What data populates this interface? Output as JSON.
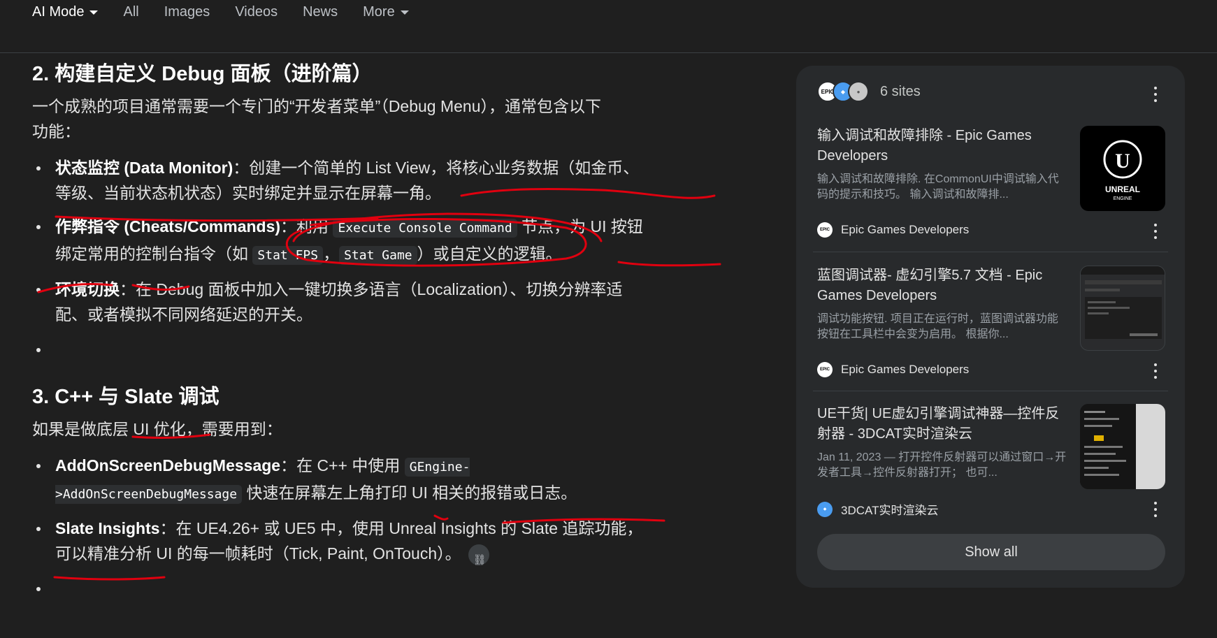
{
  "tabs": [
    {
      "label": "AI Mode",
      "active": true,
      "has_caret": true
    },
    {
      "label": "All"
    },
    {
      "label": "Images"
    },
    {
      "label": "Videos"
    },
    {
      "label": "News"
    },
    {
      "label": "More",
      "has_caret": true
    }
  ],
  "section2": {
    "heading": "2. 构建自定义 Debug 面板（进阶篇）",
    "intro": "一个成熟的项目通常需要一个专门的“开发者菜单”（Debug Menu），通常包含以下功能：",
    "items": [
      {
        "bold": "状态监控 (Data Monitor)",
        "text": "：创建一个简单的 List View，将核心业务数据（如金币、等级、当前状态机状态）实时绑定并显示在屏幕一角。"
      },
      {
        "bold": "作弊指令 (Cheats/Commands)",
        "t1": "：利用 ",
        "code1": "Execute Console Command",
        "t2": " 节点，为 UI 按钮绑定常用的控制台指令（如 ",
        "code2": "Stat FPS",
        "t3": "，",
        "code3": "Stat Game",
        "t4": "）或自定义的逻辑。"
      },
      {
        "bold": "环境切换",
        "text": "：在 Debug 面板中加入一键切换多语言（Localization）、切换分辨率适配、或者模拟不同网络延迟的开关。"
      }
    ]
  },
  "section3": {
    "heading": "3. C++ 与 Slate 调试",
    "intro": "如果是做底层 UI 优化，需要用到：",
    "items": [
      {
        "bold": "AddOnScreenDebugMessage",
        "t1": "：在 C++ 中使用 ",
        "code1": "GEngine->AddOnScreenDebugMessage",
        "t2": " 快速在屏幕左上角打印 UI 相关的报错或日志。"
      },
      {
        "bold": "Slate Insights",
        "t1": "：在 UE4.26+ 或 UE5 中，使用 Unreal Insights 的 Slate 追踪功能，可以精准分析 UI 的每一帧耗时（Tick, Paint, OnTouch）。"
      }
    ]
  },
  "panel": {
    "sites_label": "6 sites",
    "cards": [
      {
        "title": "输入调试和故障排除 - Epic Games Developers",
        "desc": "输入调试和故障排除. 在CommonUI中调试输入代码的提示和技巧。 输入调试和故障排...",
        "source": "Epic Games Developers",
        "thumb": "unreal-engine-logo",
        "thumb_text_1": "UNREAL",
        "thumb_text_2": "ENGINE"
      },
      {
        "title": "蓝图调试器- 虚幻引擎5.7 文档 - Epic Games Developers",
        "desc": "调试功能按钮. 项目正在运行时，蓝图调试器功能按钮在工具栏中会变为启用。 根据你...",
        "source": "Epic Games Developers",
        "thumb": "blueprint-debugger-screenshot"
      },
      {
        "title": "UE干货| UE虚幻引擎调试神器—控件反射器 - 3DCAT实时渲染云",
        "desc": "Jan 11, 2023 — 打开控件反射器可以通过窗口→开发者工具→控件反射器打开； 也可...",
        "source": "3DCAT实时渲染云",
        "thumb": "widget-reflector-screenshot"
      }
    ],
    "show_all": "Show all"
  },
  "colors": {
    "background": "#1f1f1f",
    "panel": "#282a2c",
    "annotation": "#e0000f"
  }
}
